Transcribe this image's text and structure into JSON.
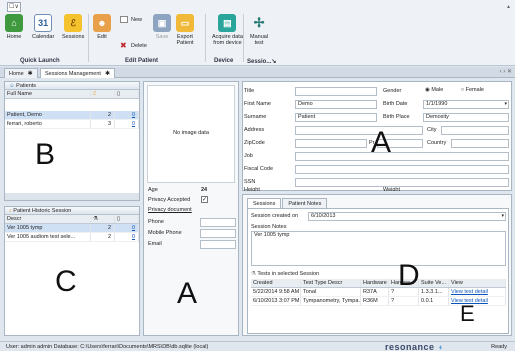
{
  "ribbon": {
    "app_tab": "☐∨",
    "buttons": {
      "home": "Home",
      "calendar": "Calendar",
      "calendar_day": "31",
      "sessions": "Sessions",
      "edit": "Edit",
      "new": "New",
      "delete": "Delete",
      "save": "Save",
      "export": "Export\nPatient",
      "acquire": "Acquire data\nfrom device",
      "manual": "Manual\ntest"
    },
    "groups": {
      "quick_launch": "Quick Launch",
      "edit_patient": "Edit Patient",
      "device": "Device",
      "session": "Sessio...↘"
    }
  },
  "doc_tabs": [
    {
      "label": "Home"
    },
    {
      "label": "Sessions Management"
    }
  ],
  "patients": {
    "title": "Patients",
    "columns": {
      "name": "Full Name",
      "c2": "",
      "c3": ""
    },
    "rows": [
      {
        "name": "Patient, Demo",
        "n": "2",
        "m": "0"
      },
      {
        "name": "ferrari, roberto",
        "n": "3",
        "m": "0"
      }
    ]
  },
  "history": {
    "title": "Patient Historic Session",
    "columns": {
      "descr": "Descr",
      "c2": "",
      "c3": ""
    },
    "rows": [
      {
        "descr": "Ver 1005 tymp",
        "n": "2",
        "m": "0"
      },
      {
        "descr": "Ver 1005 audiom test sele...",
        "n": "2",
        "m": "0"
      }
    ]
  },
  "photo": {
    "no_image": "No image data",
    "age_label": "Age",
    "age_value": "24",
    "privacy_label": "Privacy Accepted",
    "privacy_doc": "Privacy document",
    "phone": "Phone",
    "mobile": "Mobile Phone",
    "email": "Email"
  },
  "details": {
    "title": "Title",
    "gender": "Gender",
    "male": "Male",
    "female": "Female",
    "first_name_label": "First Name",
    "first_name": "Demo",
    "birth_date_label": "Birth Date",
    "birth_date": "1/1/1990",
    "surname_label": "Surname",
    "surname": "Patient",
    "birth_place_label": "Birth Place",
    "birth_place": "Demoxity",
    "address": "Address",
    "city": "City",
    "zip": "ZipCode",
    "province": "Pr",
    "country": "Country",
    "job": "Job",
    "fiscal": "Fiscal Code",
    "ssn": "SSN",
    "height": "Height",
    "weight": "Weight"
  },
  "session": {
    "tabs": [
      "Sessions",
      "Patient Notes"
    ],
    "created_label": "Session created on",
    "created_value": "6/10/2013",
    "notes_label": "Session Notes",
    "notes_value": "Ver 1005 tymp",
    "tests_title": "Tests in selected Session",
    "columns": [
      "Created",
      "Test Type Descr",
      "Hardware",
      "Hardwa...",
      "Suite Ve...",
      "View"
    ],
    "rows": [
      {
        "created": "5/22/2014 9:58 AM",
        "type": "Tonal",
        "hw": "R37A",
        "hw2": "?",
        "suite": "1.3.3.1...",
        "view": "View test detail"
      },
      {
        "created": "6/10/2013 3:07 PM",
        "type": "Tympanometry, Tympa...",
        "hw": "R36M",
        "hw2": "?",
        "suite": "0.0.1",
        "view": "View test detail"
      }
    ]
  },
  "annotations": {
    "a1": "A",
    "a2": "A",
    "b": "B",
    "c": "C",
    "d": "D",
    "e": "E"
  },
  "status": {
    "text": "User: admin admin   Database: C:\\Users\\ferrari\\Documents\\MRS\\DB\\db.sqlite (local)",
    "brand": "resonance",
    "ready": "Ready"
  },
  "colors": {
    "accent": "#2f6fb3",
    "selection": "#cfe0f5",
    "brand": "#3a4a6a"
  }
}
